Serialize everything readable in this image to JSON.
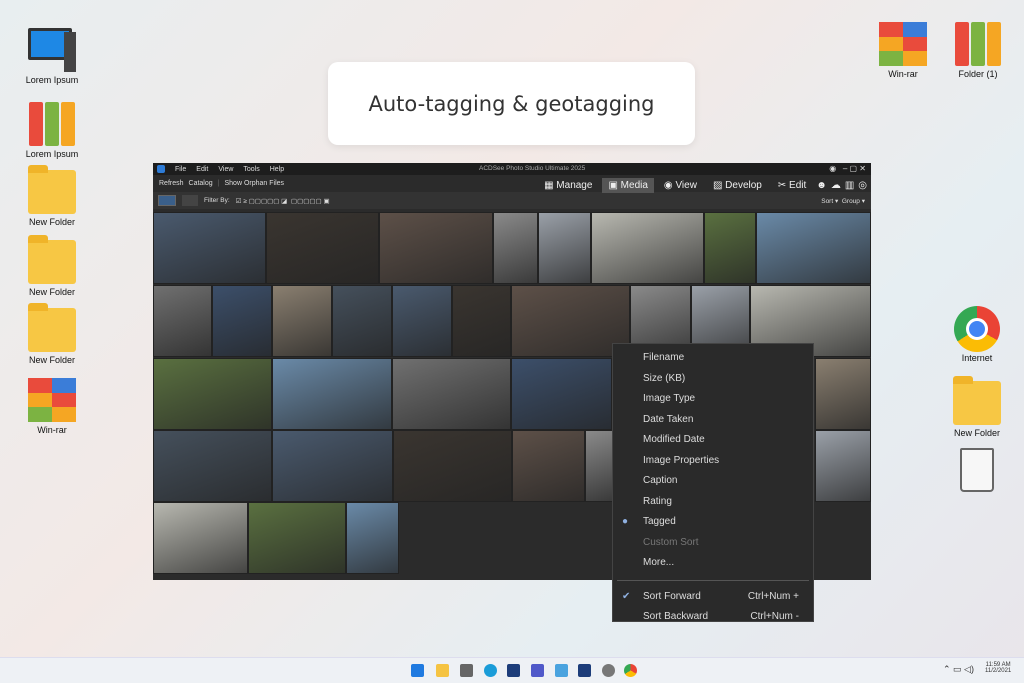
{
  "desktop_left": [
    {
      "label": "Lorem Ipsum",
      "type": "computer"
    },
    {
      "label": "Lorem Ipsum",
      "type": "binders"
    },
    {
      "label": "New Folder",
      "type": "folder"
    },
    {
      "label": "New Folder",
      "type": "folder"
    },
    {
      "label": "New Folder",
      "type": "folder"
    },
    {
      "label": "Win-rar",
      "type": "rar"
    }
  ],
  "desktop_right": {
    "winrar": "Win-rar",
    "folder1": "Folder (1)",
    "internet": "Internet",
    "newfolder": "New Folder"
  },
  "banner": "Auto-tagging & geotagging",
  "app": {
    "title": "ACDSee Photo Studio Ultimate 2025",
    "menu": [
      "File",
      "Edit",
      "View",
      "Tools",
      "Help"
    ],
    "toolbar": [
      "Refresh",
      "Catalog",
      "Show Orphan Files"
    ],
    "modes": [
      "Manage",
      "Media",
      "View",
      "Develop",
      "Edit"
    ],
    "active_mode": "Media",
    "filter_label": "Filter By:",
    "sort": "Sort",
    "group": "Group"
  },
  "sort_menu": {
    "items": [
      {
        "label": "Filename"
      },
      {
        "label": "Size (KB)"
      },
      {
        "label": "Image Type"
      },
      {
        "label": "Date Taken"
      },
      {
        "label": "Modified Date"
      },
      {
        "label": "Image Properties"
      },
      {
        "label": "Caption"
      },
      {
        "label": "Rating"
      },
      {
        "label": "Tagged",
        "selected": true
      },
      {
        "label": "Custom Sort",
        "disabled": true
      },
      {
        "label": "More..."
      }
    ],
    "order": [
      {
        "label": "Sort Forward",
        "shortcut": "Ctrl+Num +",
        "checked": true
      },
      {
        "label": "Sort Backward",
        "shortcut": "Ctrl+Num -"
      }
    ]
  },
  "taskbar": {
    "time": "11:59 AM",
    "date": "11/2/2021"
  }
}
